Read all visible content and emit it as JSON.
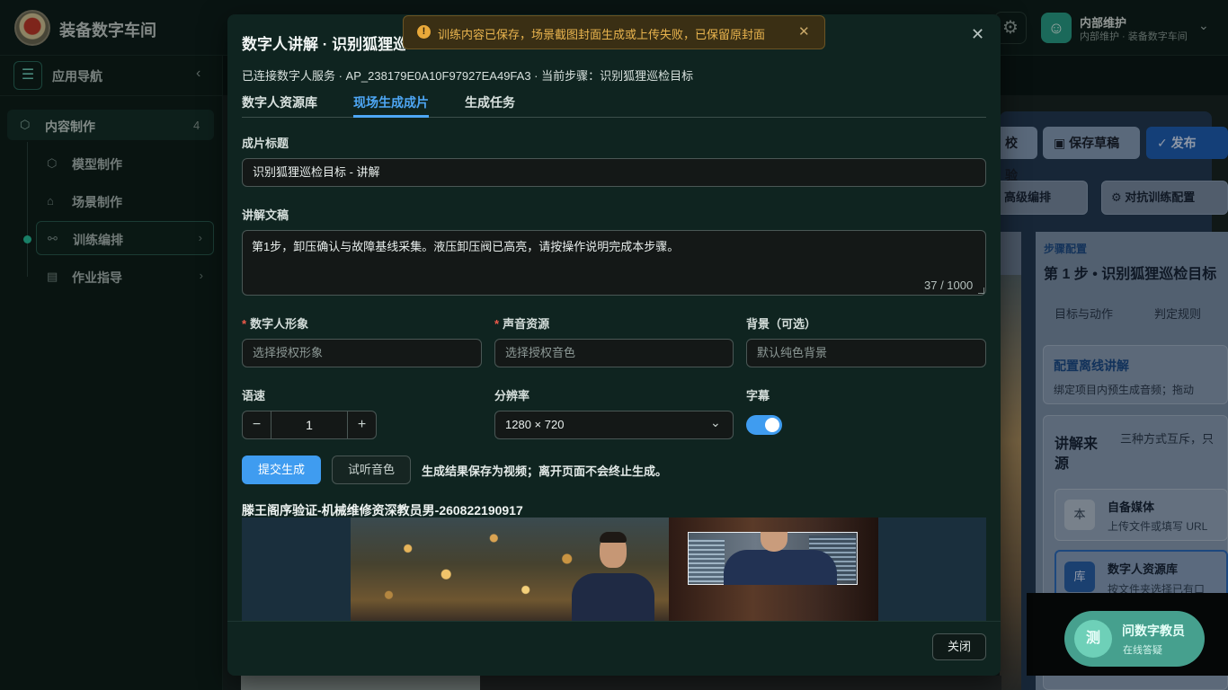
{
  "app": {
    "title": "装备数字车间",
    "user_name": "内部维护",
    "user_sub": "内部维护 · 装备数字车间"
  },
  "sidebar": {
    "title": "应用导航",
    "group": {
      "label": "内容制作",
      "count": "4"
    },
    "items": [
      {
        "label": "模型制作"
      },
      {
        "label": "场景制作"
      },
      {
        "label": "训练编排"
      },
      {
        "label": "作业指导"
      }
    ]
  },
  "background": {
    "btn_check": "校验",
    "btn_draft": "保存草稿",
    "btn_publish": "发布",
    "btn_advanced": "高级编排",
    "btn_adversarial": "对抗训练配置",
    "step_config_label": "步骤配置",
    "step_title": "第 1 步 • 识别狐狸巡检目标",
    "tab_target": "目标与动作",
    "tab_judge": "判定规则",
    "offline_title": "配置离线讲解",
    "offline_desc": "绑定项目内预生成音频；拖动",
    "source_title_line1": "讲解来",
    "source_title_line2": "源",
    "source_desc": "三种方式互斥，只",
    "opt1_badge": "本",
    "opt1_title": "自备媒体",
    "opt1_desc": "上传文件或填写 URL",
    "opt2_badge": "库",
    "opt2_title": "数字人资源库",
    "opt2_desc": "按文件夹选择已有口",
    "assistant_badge": "测",
    "assistant_title": "问数字教员",
    "assistant_sub": "在线答疑"
  },
  "toast": {
    "message": "训练内容已保存，场景截图封面生成或上传失败，已保留原封面"
  },
  "dialog": {
    "title": "数字人讲解 · 识别狐狸巡检目标",
    "status": "已连接数字人服务 · AP_238179E0A10F97927EA49FA3 · 当前步骤：识别狐狸巡检目标",
    "tabs": [
      "数字人资源库",
      "现场生成成片",
      "生成任务"
    ],
    "form": {
      "title_label": "成片标题",
      "title_value": "识别狐狸巡检目标 - 讲解",
      "script_label": "讲解文稿",
      "script_value": "第1步，卸压确认与故障基线采集。液压卸压阀已高亮，请按操作说明完成本步骤。",
      "script_count": "37 / 1000",
      "avatar_label": "数字人形象",
      "avatar_placeholder": "选择授权形象",
      "voice_label": "声音资源",
      "voice_placeholder": "选择授权音色",
      "bg_label": "背景（可选）",
      "bg_placeholder": "默认纯色背景",
      "speed_label": "语速",
      "speed_value": "1",
      "resolution_label": "分辨率",
      "resolution_value": "1280 × 720",
      "subtitle_label": "字幕",
      "subtitle_on": true
    },
    "submit_label": "提交生成",
    "preview_voice_label": "试听音色",
    "hint": "生成结果保存为视频；离开页面不会终止生成。",
    "video_title": "滕王阁序验证-机械维修资深教员男-260822190917",
    "close_label": "关闭"
  },
  "colors": {
    "accent": "#3f9cf0",
    "dialog_bg": "#0f2420",
    "toast_text": "#e9b44e",
    "required": "#f05a4a"
  }
}
